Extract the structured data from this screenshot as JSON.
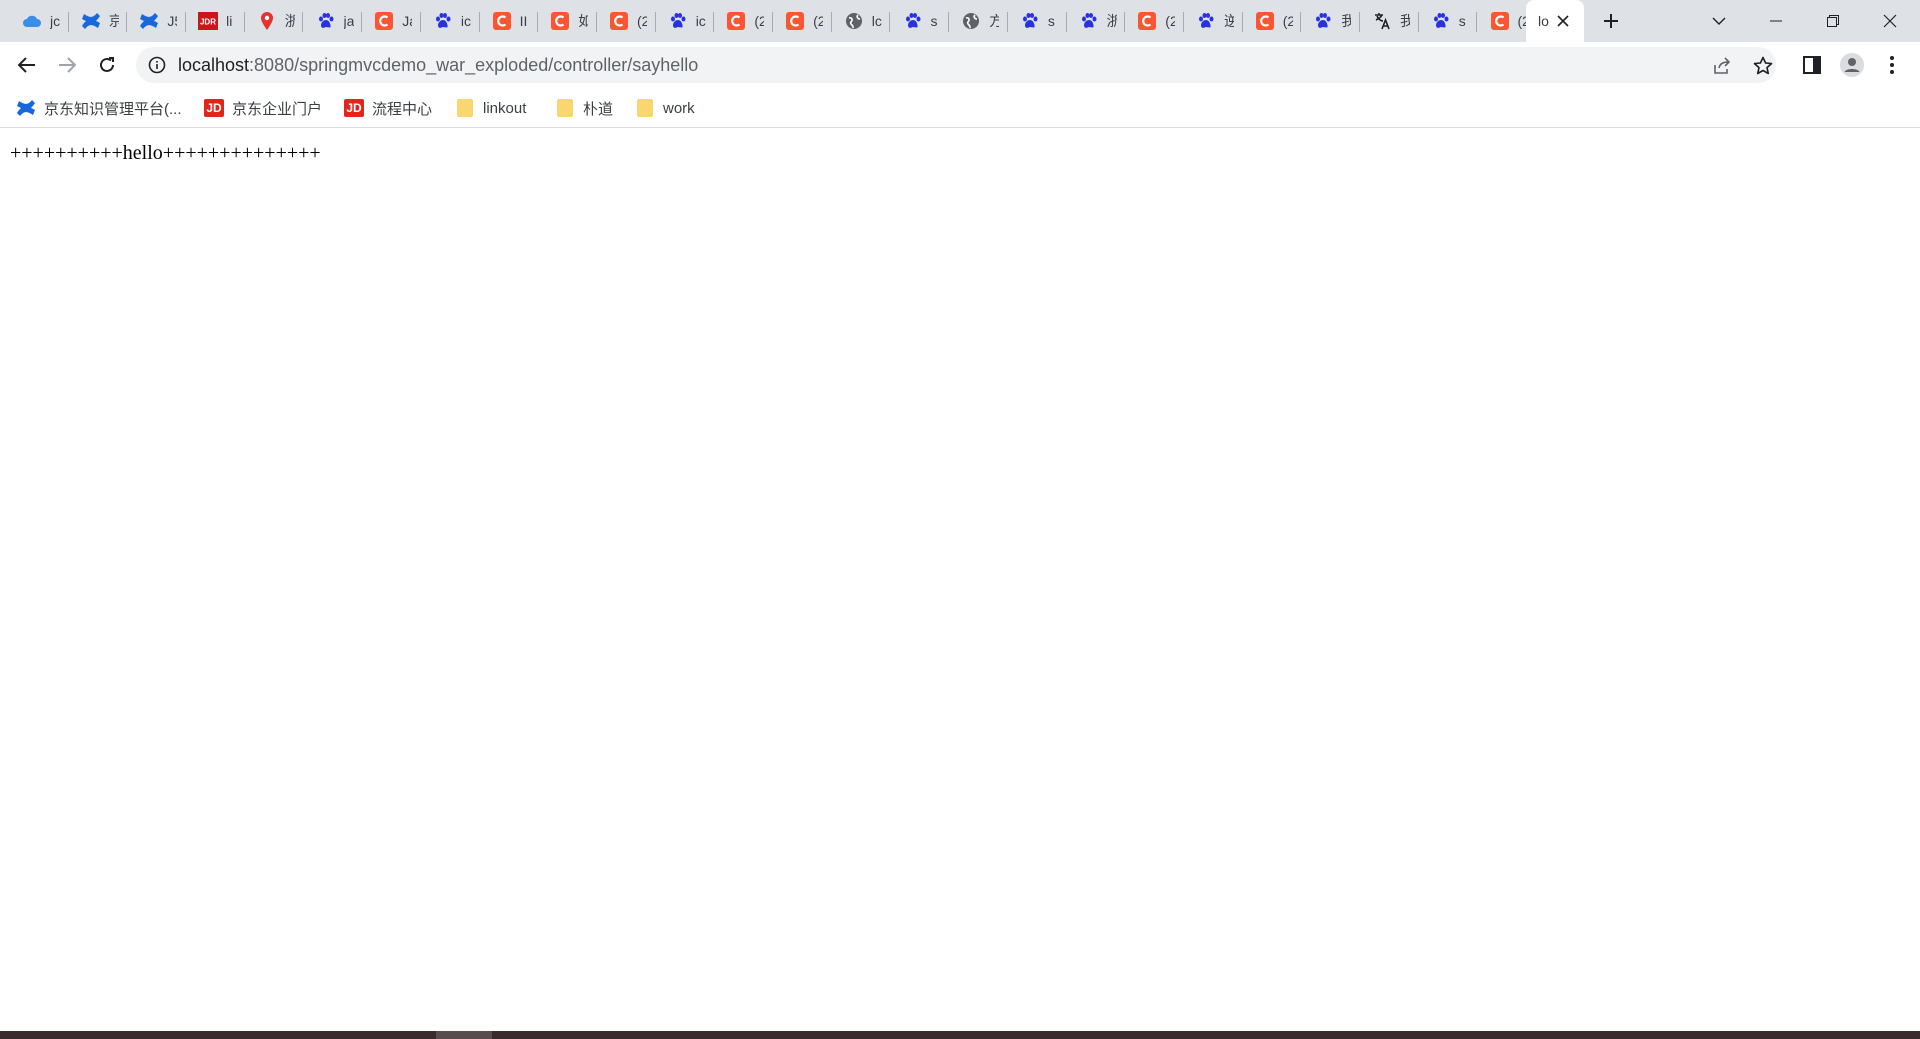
{
  "tabs": [
    {
      "title": "jc",
      "icon": "cloud-icon"
    },
    {
      "title": "京",
      "icon": "confluence-icon"
    },
    {
      "title": "J5",
      "icon": "confluence-icon"
    },
    {
      "title": "li",
      "icon": "jdr-icon"
    },
    {
      "title": "浙",
      "icon": "map-pin-icon"
    },
    {
      "title": "ja",
      "icon": "baidu-paw-icon"
    },
    {
      "title": "Ja",
      "icon": "csdn-icon"
    },
    {
      "title": "ic",
      "icon": "baidu-paw-icon"
    },
    {
      "title": "II",
      "icon": "csdn-icon"
    },
    {
      "title": "如",
      "icon": "csdn-icon"
    },
    {
      "title": "(2",
      "icon": "csdn-icon"
    },
    {
      "title": "ic",
      "icon": "baidu-paw-icon"
    },
    {
      "title": "(2",
      "icon": "csdn-icon"
    },
    {
      "title": "(2",
      "icon": "csdn-icon"
    },
    {
      "title": "lc",
      "icon": "globe-icon"
    },
    {
      "title": "s",
      "icon": "baidu-paw-icon"
    },
    {
      "title": "方",
      "icon": "globe-icon"
    },
    {
      "title": "s",
      "icon": "baidu-paw-icon"
    },
    {
      "title": "浙",
      "icon": "baidu-paw-icon"
    },
    {
      "title": "(2",
      "icon": "csdn-icon"
    },
    {
      "title": "逆",
      "icon": "baidu-paw-icon"
    },
    {
      "title": "(2",
      "icon": "csdn-icon"
    },
    {
      "title": "我",
      "icon": "baidu-paw-icon"
    },
    {
      "title": "我",
      "icon": "translate-icon"
    },
    {
      "title": "s",
      "icon": "baidu-paw-icon"
    },
    {
      "title": "(2",
      "icon": "csdn-icon"
    }
  ],
  "active_tab": {
    "title": "lo",
    "icon": "none"
  },
  "address_bar": {
    "host": "localhost",
    "path": ":8080/springmvcdemo_war_exploded/controller/sayhello"
  },
  "bookmarks": [
    {
      "label": "京东知识管理平台(...",
      "icon": "confluence-icon"
    },
    {
      "label": "京东企业门户",
      "icon": "jd-icon",
      "icon_text": "JD"
    },
    {
      "label": "流程中心",
      "icon": "jd-icon",
      "icon_text": "JD"
    },
    {
      "label": "linkout",
      "icon": "folder-icon"
    },
    {
      "label": "朴道",
      "icon": "folder-icon"
    },
    {
      "label": "work",
      "icon": "folder-icon"
    }
  ],
  "page_text": "++++++++++hello++++++++++++++",
  "colors": {
    "tabstrip_bg": "#dee1e6",
    "omnibox_bg": "#f1f3f4",
    "csdn_red": "#fc5531",
    "baidu_blue": "#2932e1",
    "confluence_blue": "#1868db"
  }
}
